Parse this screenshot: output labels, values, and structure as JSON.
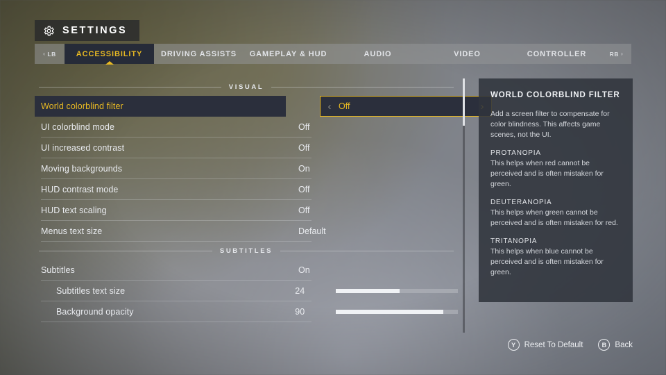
{
  "header": {
    "icon": "gear-icon",
    "title": "SETTINGS"
  },
  "tabbar": {
    "left_bumper": "LB",
    "left_bumper_chevron": "‹",
    "right_bumper": "RB",
    "right_bumper_chevron": "›",
    "tabs": [
      {
        "label": "ACCESSIBILITY",
        "active": true
      },
      {
        "label": "DRIVING ASSISTS",
        "active": false
      },
      {
        "label": "GAMEPLAY & HUD",
        "active": false
      },
      {
        "label": "AUDIO",
        "active": false
      },
      {
        "label": "VIDEO",
        "active": false
      },
      {
        "label": "CONTROLLER",
        "active": false
      }
    ]
  },
  "sections": [
    {
      "heading": "VISUAL",
      "rows": [
        {
          "name": "World colorblind filter",
          "value": "Off",
          "type": "option",
          "selected": true,
          "left_arrow": "‹",
          "right_arrow": "›"
        },
        {
          "name": "UI colorblind mode",
          "value": "Off",
          "type": "option",
          "selected": false
        },
        {
          "name": "UI increased contrast",
          "value": "Off",
          "type": "option",
          "selected": false
        },
        {
          "name": "Moving backgrounds",
          "value": "On",
          "type": "option",
          "selected": false
        },
        {
          "name": "HUD contrast mode",
          "value": "Off",
          "type": "option",
          "selected": false
        },
        {
          "name": "HUD text scaling",
          "value": "Off",
          "type": "option",
          "selected": false
        },
        {
          "name": "Menus text size",
          "value": "Default",
          "type": "option",
          "selected": false
        }
      ]
    },
    {
      "heading": "SUBTITLES",
      "rows": [
        {
          "name": "Subtitles",
          "value": "On",
          "type": "option",
          "selected": false
        },
        {
          "name": "Subtitles text size",
          "value": "24",
          "type": "slider",
          "fill_percent": 52,
          "indent": true,
          "selected": false
        },
        {
          "name": "Background opacity",
          "value": "90",
          "type": "slider",
          "fill_percent": 88,
          "indent": true,
          "selected": false
        }
      ]
    }
  ],
  "description": {
    "title": "WORLD COLORBLIND FILTER",
    "intro": "Add a screen filter to compensate for color blindness. This affects game scenes, not the UI.",
    "entries": [
      {
        "term": "PROTANOPIA",
        "text": "This helps when red cannot be perceived and is often mistaken for green."
      },
      {
        "term": "DEUTERANOPIA",
        "text": "This helps when green cannot be perceived and is often mistaken for red."
      },
      {
        "term": "TRITANOPIA",
        "text": "This helps when blue cannot be perceived and is often mistaken for green."
      }
    ]
  },
  "footer": {
    "hints": [
      {
        "button": "Y",
        "label": "Reset To Default"
      },
      {
        "button": "B",
        "label": "Back"
      }
    ]
  },
  "colors": {
    "accent_yellow": "#e8b923",
    "selected_row_bg": "#2b2f3c",
    "panel_bg": "rgba(48,52,60,0.88)",
    "text_primary": "#e9ebef"
  }
}
